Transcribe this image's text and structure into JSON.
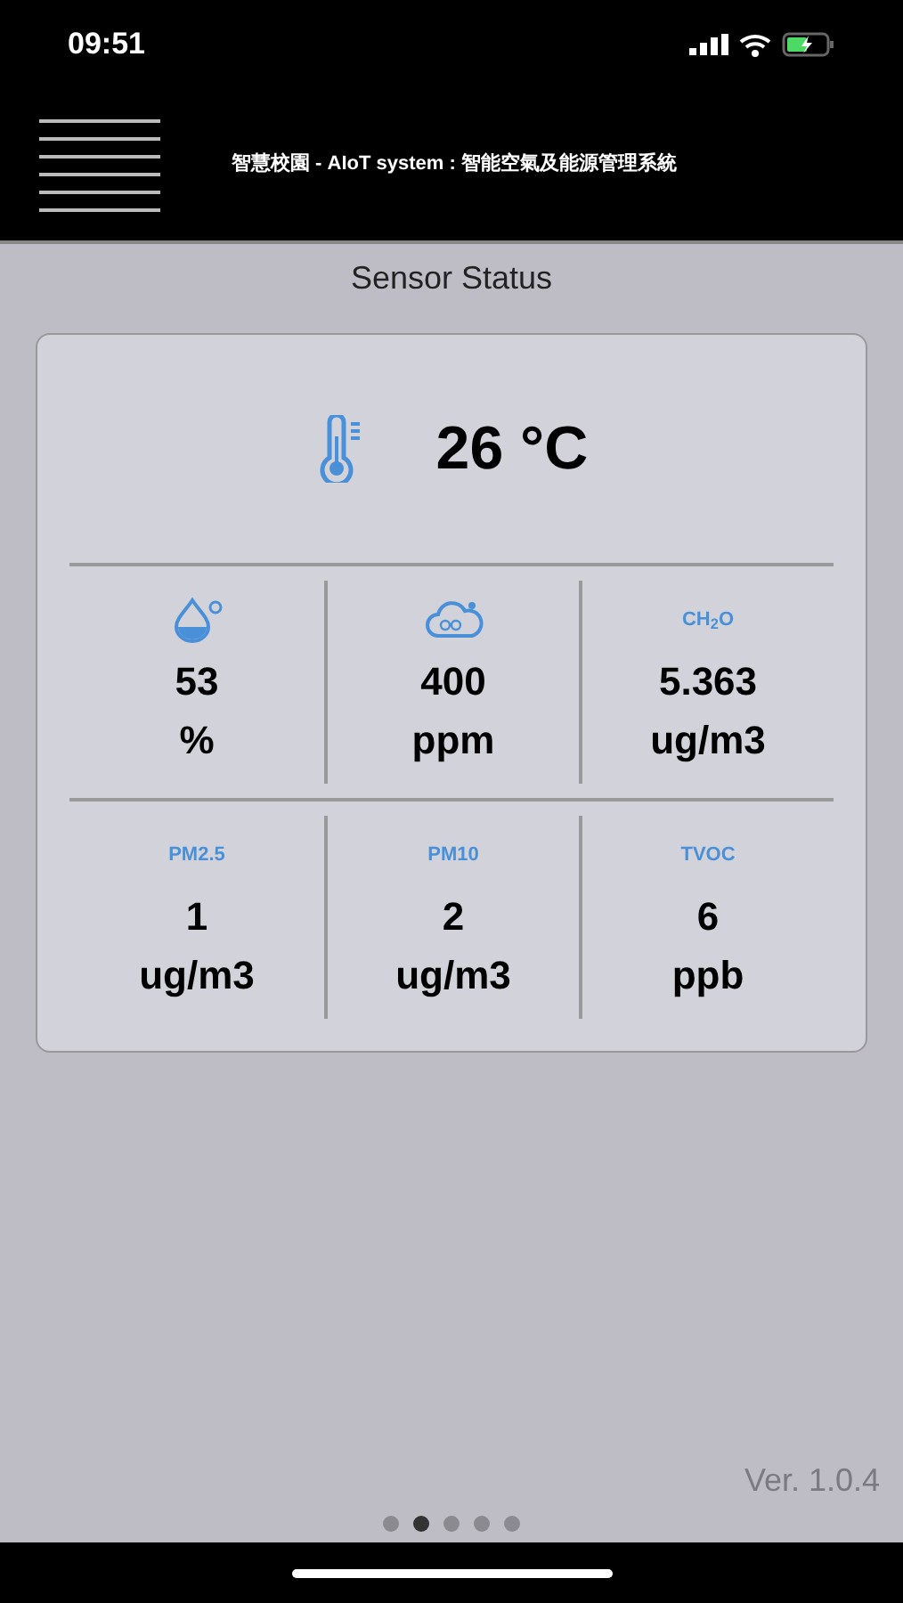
{
  "status_bar": {
    "time": "09:51"
  },
  "header": {
    "title": "智慧校園 - AIoT system : 智能空氣及能源管理系統"
  },
  "page_title": "Sensor Status",
  "temperature": {
    "value": "26 °C"
  },
  "rows": [
    [
      {
        "kind": "drop",
        "value": "53",
        "unit": "%"
      },
      {
        "kind": "cloud",
        "value": "400",
        "unit": "ppm"
      },
      {
        "kind": "label",
        "label": "CH$_{2}$O",
        "value": "5.363",
        "unit": "ug/m3"
      }
    ],
    [
      {
        "kind": "label",
        "label": "PM2.5",
        "value": "1",
        "unit": "ug/m3"
      },
      {
        "kind": "label",
        "label": "PM10",
        "value": "2",
        "unit": "ug/m3"
      },
      {
        "kind": "label",
        "label": "TVOC",
        "value": "6",
        "unit": "ppb"
      }
    ]
  ],
  "version": "Ver. 1.0.4",
  "pages": [
    {
      "selected": false
    },
    {
      "selected": true
    },
    {
      "selected": false
    },
    {
      "selected": false
    },
    {
      "selected": false
    }
  ]
}
